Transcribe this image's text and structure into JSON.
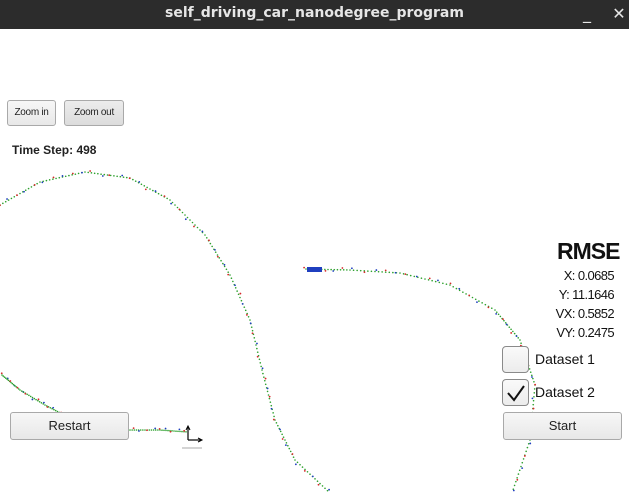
{
  "window": {
    "title": "self_driving_car_nanodegree_program",
    "minimize_glyph": "_",
    "close_glyph": "✕"
  },
  "toolbar": {
    "zoom_in_label": "Zoom in",
    "zoom_out_label": "Zoom out"
  },
  "status": {
    "time_step_label": "Time Step: 498"
  },
  "rmse": {
    "title": "RMSE",
    "x": "X: 0.0685",
    "y": "Y: 11.1646",
    "vx": "VX: 0.5852",
    "vy": "VY: 0.2475"
  },
  "datasets": [
    {
      "label": "Dataset 1",
      "checked": false
    },
    {
      "label": "Dataset 2",
      "checked": true
    }
  ],
  "controls": {
    "restart_label": "Restart",
    "start_label": "Start"
  },
  "colors": {
    "track": "#2ca02c",
    "lidar": "#d62728",
    "radar": "#1f3fbf",
    "car": "#1f3fbf"
  }
}
